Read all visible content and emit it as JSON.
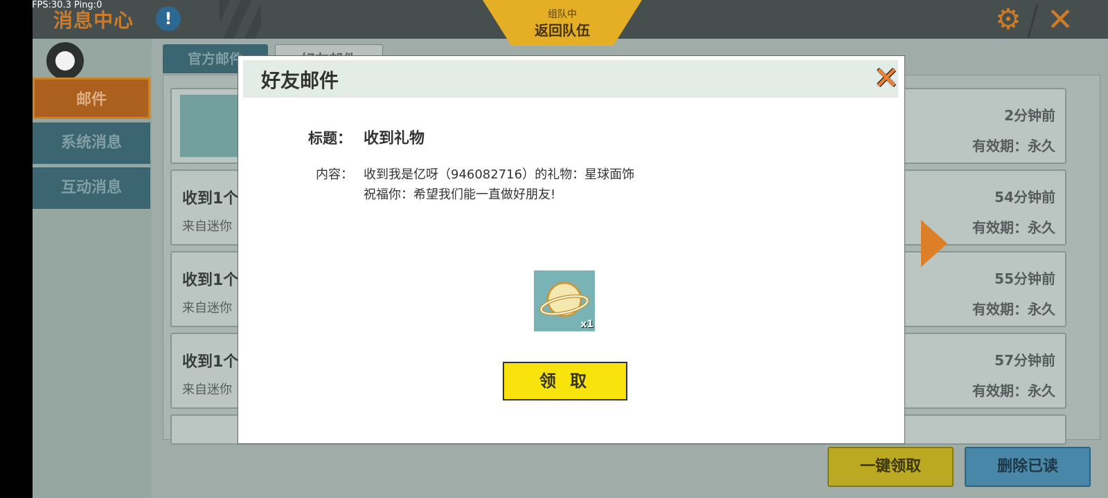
{
  "debug": {
    "fps_text": "FPS:30.3  Ping:0"
  },
  "header": {
    "title": "消息中心",
    "team_sub": "组队中",
    "team_main": "返回队伍"
  },
  "sidebar": {
    "items": [
      {
        "label": "邮件",
        "active": true
      },
      {
        "label": "系统消息",
        "active": false
      },
      {
        "label": "互动消息",
        "active": false
      }
    ]
  },
  "tabs": [
    {
      "label": "官方邮件"
    },
    {
      "label": "好友邮件"
    }
  ],
  "mail_list": [
    {
      "title": "",
      "from": "",
      "time": "2分钟前",
      "validity": "有效期：永久"
    },
    {
      "title": "收到1个",
      "from": "来自迷你",
      "time": "54分钟前",
      "validity": "有效期：永久"
    },
    {
      "title": "收到1个",
      "from": "来自迷你",
      "time": "55分钟前",
      "validity": "有效期：永久"
    },
    {
      "title": "收到1个",
      "from": "来自迷你",
      "time": "57分钟前",
      "validity": "有效期：永久"
    }
  ],
  "bottom_buttons": {
    "claim_all": "一键领取",
    "delete_read": "删除已读"
  },
  "dialog": {
    "title": "好友邮件",
    "subject_label": "标题：",
    "subject": "收到礼物",
    "content_label": "内容：",
    "content_line1": "收到我是亿呀（946082716）的礼物：星球面饰",
    "content_line2": "祝福你：希望我们能一直做好朋友!",
    "item_count": "x1",
    "claim_button": "领 取"
  },
  "colors": {
    "accent_orange": "#d9822b",
    "claim_yellow": "#f8e30d",
    "sidebar_active": "#b5671f"
  }
}
